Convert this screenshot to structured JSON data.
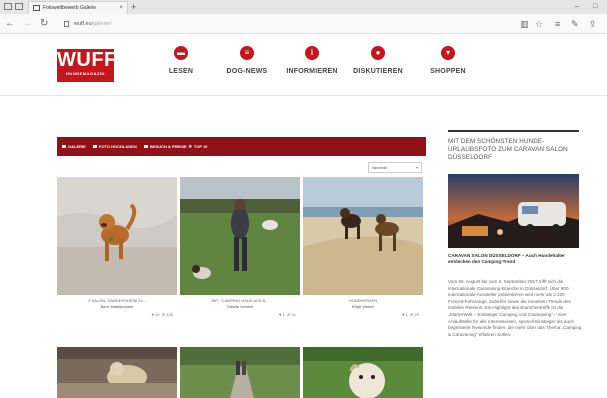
{
  "browser": {
    "tab_title": "Fotowettbewerb Galerie",
    "tab_close": "×",
    "new_tab": "+",
    "window_controls": [
      "–",
      "□"
    ],
    "url_domain": "wuff.eu",
    "url_path": "/galerie/",
    "nav_icons": [
      "back-icon",
      "forward-icon",
      "refresh-icon"
    ],
    "right_icons": [
      "reading-view-icon",
      "favorite-star-icon",
      "hub-icon",
      "notes-icon",
      "share-icon"
    ]
  },
  "site": {
    "logo_main": "WUFF",
    "logo_sub": "HUNDEMAGAZIN",
    "accent_color": "#c4161c",
    "nav": [
      {
        "label": "LESEN",
        "icon": "book-icon"
      },
      {
        "label": "DOG-NEWS",
        "icon": "news-icon"
      },
      {
        "label": "INFORMIEREN",
        "icon": "info-icon"
      },
      {
        "label": "DISKUTIEREN",
        "icon": "chat-icon"
      },
      {
        "label": "SHOPPEN",
        "icon": "cart-icon"
      }
    ]
  },
  "gallery": {
    "bar_color": "#8f1218",
    "tabs": [
      "GALERIE",
      "FOTO HOCHLADEN",
      "BESUCH & PREISE",
      "TOP 10"
    ],
    "sort_value": "Neueste",
    "cards": [
      {
        "title": "3 SALON, GANDERSHEIM 24...",
        "author": "Bern Waldshauser",
        "likes": "10",
        "comments": "135"
      },
      {
        "title": "BIR - CAMPING HAUS AUS B...",
        "author": "Gisella Schmid",
        "likes": "1",
        "comments": "31"
      },
      {
        "title": "HUNDHERZEN",
        "author": "Birgit Weber",
        "likes": "1",
        "comments": "25"
      }
    ]
  },
  "sidebar": {
    "title": "MIT DEM SCHÖNSTEN HUNDE-URLAUBSFOTO ZUM CARAVAN SALON DÜSSELDORF",
    "headline": "CARAVAN SALON DÜSSELDORF – Auch Hundehalter entdecken den Camping-Trend",
    "body": "Vom 26. August bis zum 3. September 2017 trifft sich die internationale Caravaning-Branche in Düsseldorf. Über 600 internationale Aussteller präsentieren weit mehr als 2.100 Freizeit-Fahrzeuge, Zubehör sowie die neuesten Trends des mobilen Reisens. Ein Highlight des Branchentreffs ist die „StarterWelt – Einsteiger Camping und Caravaning“ – eine Anlaufstelle für alle Interessenten, speziell Einsteiger als auch begeisterte Reisende finden, die mehr über das Thema „Camping & Caravaning“ erfahren wollen."
  }
}
